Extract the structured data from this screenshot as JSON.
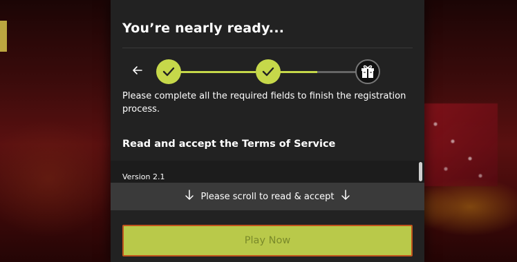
{
  "modal": {
    "title": "You’re nearly ready...",
    "description": "Please complete all the required fields to finish the registration process.",
    "section_title": "Read and accept the Terms of Service",
    "version": "Version 2.1",
    "scroll_prompt": "Please scroll to read & accept",
    "play_button": "Play Now"
  },
  "stepper": {
    "back_icon": "back-arrow-icon",
    "steps": [
      {
        "state": "done",
        "icon": "check-icon"
      },
      {
        "state": "done",
        "icon": "check-icon"
      },
      {
        "state": "pending",
        "icon": "gift-icon"
      }
    ]
  },
  "colors": {
    "accent": "#c6d84a",
    "button_bg": "#b9c94a",
    "button_border": "#c0541c",
    "modal_bg": "#222222"
  }
}
